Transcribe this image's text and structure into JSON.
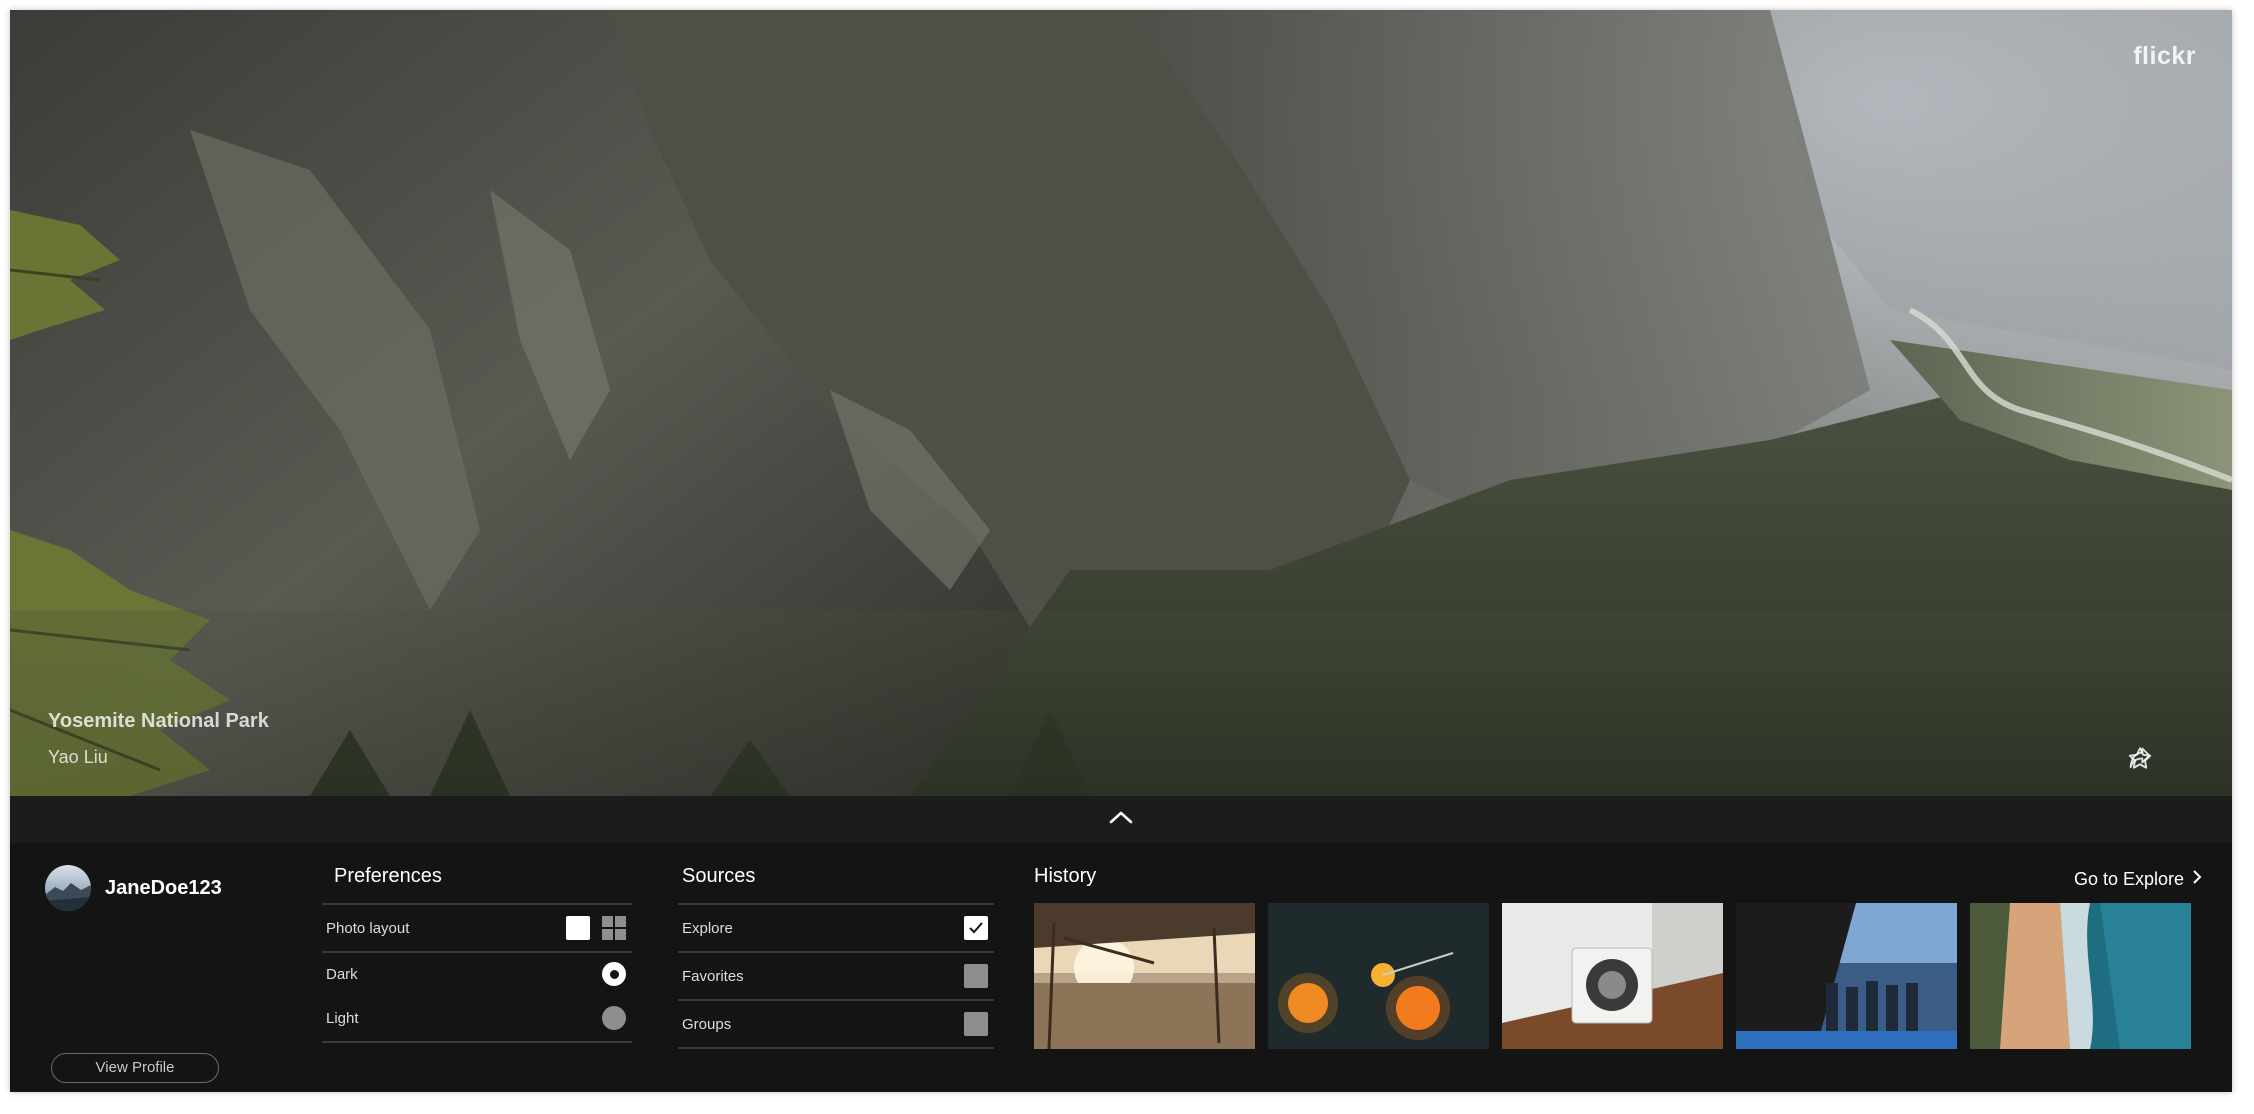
{
  "brand": {
    "logo": "flickr"
  },
  "photo": {
    "title": "Yosemite National Park",
    "author": "Yao Liu"
  },
  "hero_actions": [
    {
      "icon": "star-outline-icon",
      "label": "favorite"
    },
    {
      "icon": "share-arrow-icon",
      "label": "share"
    }
  ],
  "collapse": {
    "icon": "chevron-up-icon"
  },
  "profile": {
    "username": "JaneDoe123",
    "button": "View Profile"
  },
  "preferences": {
    "title": "Preferences",
    "photo_layout_label": "Photo layout",
    "layout_options": [
      "single",
      "grid"
    ],
    "selected_layout": "single",
    "themes": [
      {
        "label": "Dark",
        "selected": true
      },
      {
        "label": "Light",
        "selected": false
      }
    ]
  },
  "sources": {
    "title": "Sources",
    "items": [
      {
        "label": "Explore",
        "checked": true
      },
      {
        "label": "Favorites",
        "checked": false
      },
      {
        "label": "Groups",
        "checked": false
      }
    ]
  },
  "history": {
    "title": "History",
    "link": "Go to Explore",
    "thumbnails": [
      "beach-hut",
      "orange-lights",
      "speaker",
      "crowd-boardwalk",
      "aerial-coast"
    ]
  },
  "colors": {
    "panel_bg": "#141414",
    "bar_bg": "#1c1c1c",
    "divider": "#3b3b3b",
    "control_off": "#8e8e8e"
  }
}
